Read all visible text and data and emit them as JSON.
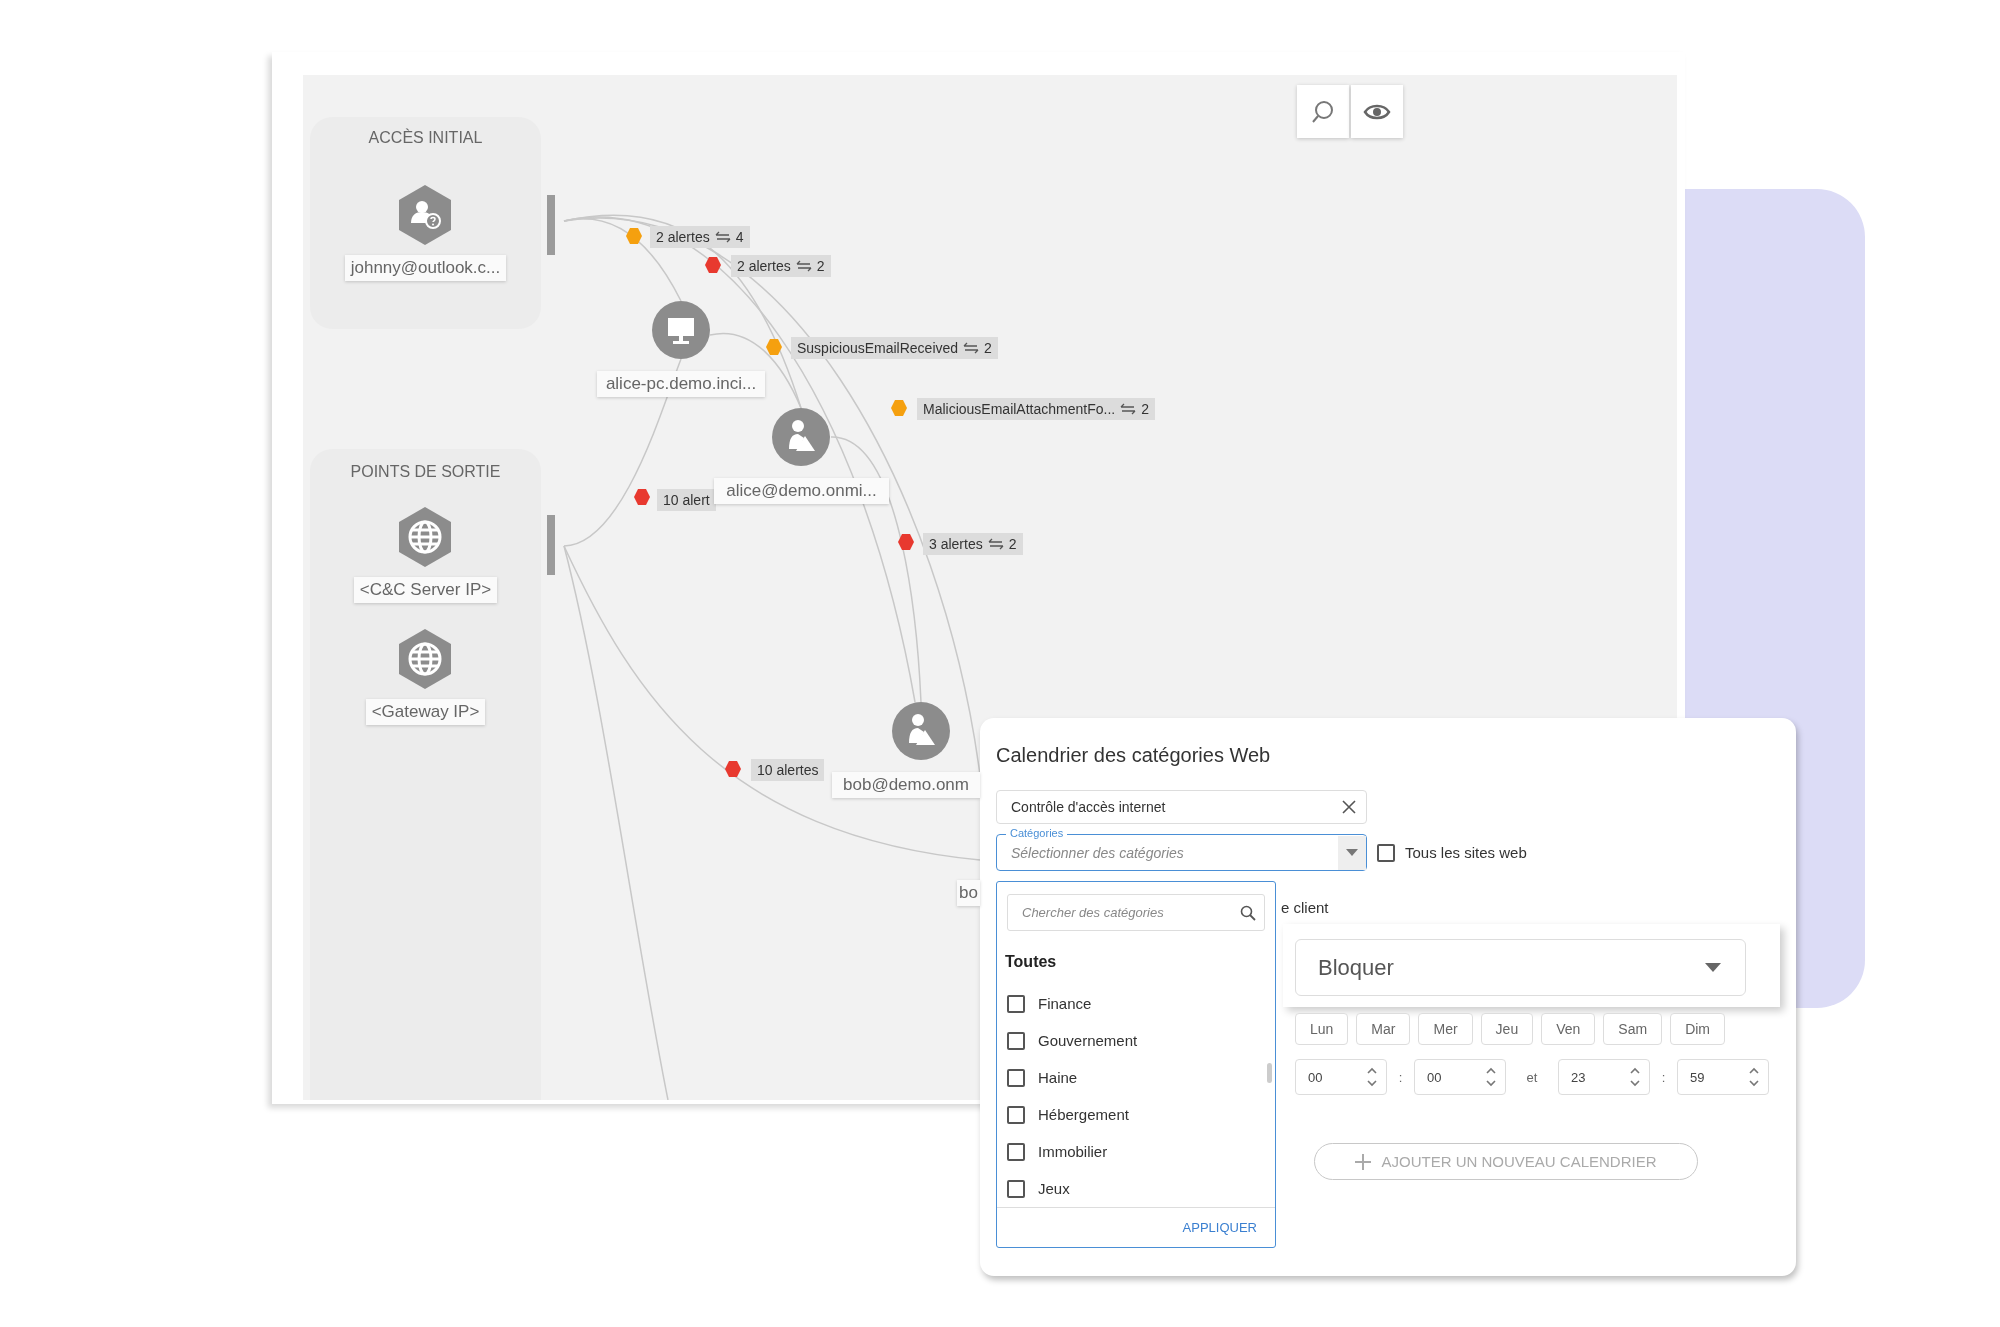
{
  "toolbar": {
    "buttons": [
      {
        "kind": "search"
      },
      {
        "kind": "eye"
      }
    ]
  },
  "sidebar_groups": [
    {
      "title": "ACCÈS INITIAL",
      "nodes": [
        {
          "kind": "user-unknown",
          "label": "johnny@outlook.c..."
        }
      ]
    },
    {
      "title": "POINTS DE SORTIE",
      "nodes": [
        {
          "kind": "globe",
          "label": "<C&C Server IP>"
        },
        {
          "kind": "globe",
          "label": "<Gateway IP>"
        }
      ]
    }
  ],
  "graph": {
    "nodes": [
      {
        "kind": "computer",
        "label": "alice-pc.demo.inci..."
      },
      {
        "kind": "user",
        "label": "alice@demo.onmi..."
      },
      {
        "kind": "user",
        "label": "bob@demo.onm"
      },
      {
        "kind": "label",
        "label": "bo"
      }
    ],
    "alerts": [
      {
        "color": "#f5a00f",
        "text": "2 alertes",
        "count": "4"
      },
      {
        "color": "#e8392f",
        "text": "2 alertes",
        "count": "2"
      },
      {
        "color": "#f5a00f",
        "text": "SuspiciousEmailReceived",
        "count": "2"
      },
      {
        "color": "#f5a00f",
        "text": "MaliciousEmailAttachmentFo...",
        "count": "2"
      },
      {
        "color": "#e8392f",
        "text": "10 alert"
      },
      {
        "color": "#e8392f",
        "text": "3 alertes",
        "count": "2"
      },
      {
        "color": "#e8392f",
        "text": "10 alertes"
      }
    ]
  },
  "dialog": {
    "title": "Calendrier des catégories Web",
    "name_field": {
      "value": "Contrôle d'accès internet"
    },
    "categories_field": {
      "label": "Catégories",
      "placeholder": "Sélectionner des catégories"
    },
    "all_sites": {
      "label": "Tous les sites web",
      "checked": false
    },
    "dropdown": {
      "search_placeholder": "Chercher des catégories",
      "group": "Toutes",
      "items": [
        {
          "label": "Finance",
          "checked": false
        },
        {
          "label": "Gouvernement",
          "checked": false
        },
        {
          "label": "Haine",
          "checked": false
        },
        {
          "label": "Hébergement",
          "checked": false
        },
        {
          "label": "Immobilier",
          "checked": false
        },
        {
          "label": "Jeux",
          "checked": false
        }
      ],
      "apply": "APPLIQUER"
    },
    "client_label": "e client",
    "action_select": {
      "value": "Bloquer"
    },
    "days": [
      {
        "label": "Lun",
        "selected": false
      },
      {
        "label": "Mar",
        "selected": false
      },
      {
        "label": "Mer",
        "selected": false
      },
      {
        "label": "Jeu",
        "selected": false
      },
      {
        "label": "Ven",
        "selected": false
      },
      {
        "label": "Sam",
        "selected": false
      },
      {
        "label": "Dim",
        "selected": false
      }
    ],
    "times": [
      {
        "value": "00"
      },
      {
        "value": "00"
      },
      {
        "value": "23"
      },
      {
        "value": "59"
      }
    ],
    "time_separators": [
      ":",
      "et",
      ":"
    ],
    "add_button": "AJOUTER UN NOUVEAU CALENDRIER"
  }
}
